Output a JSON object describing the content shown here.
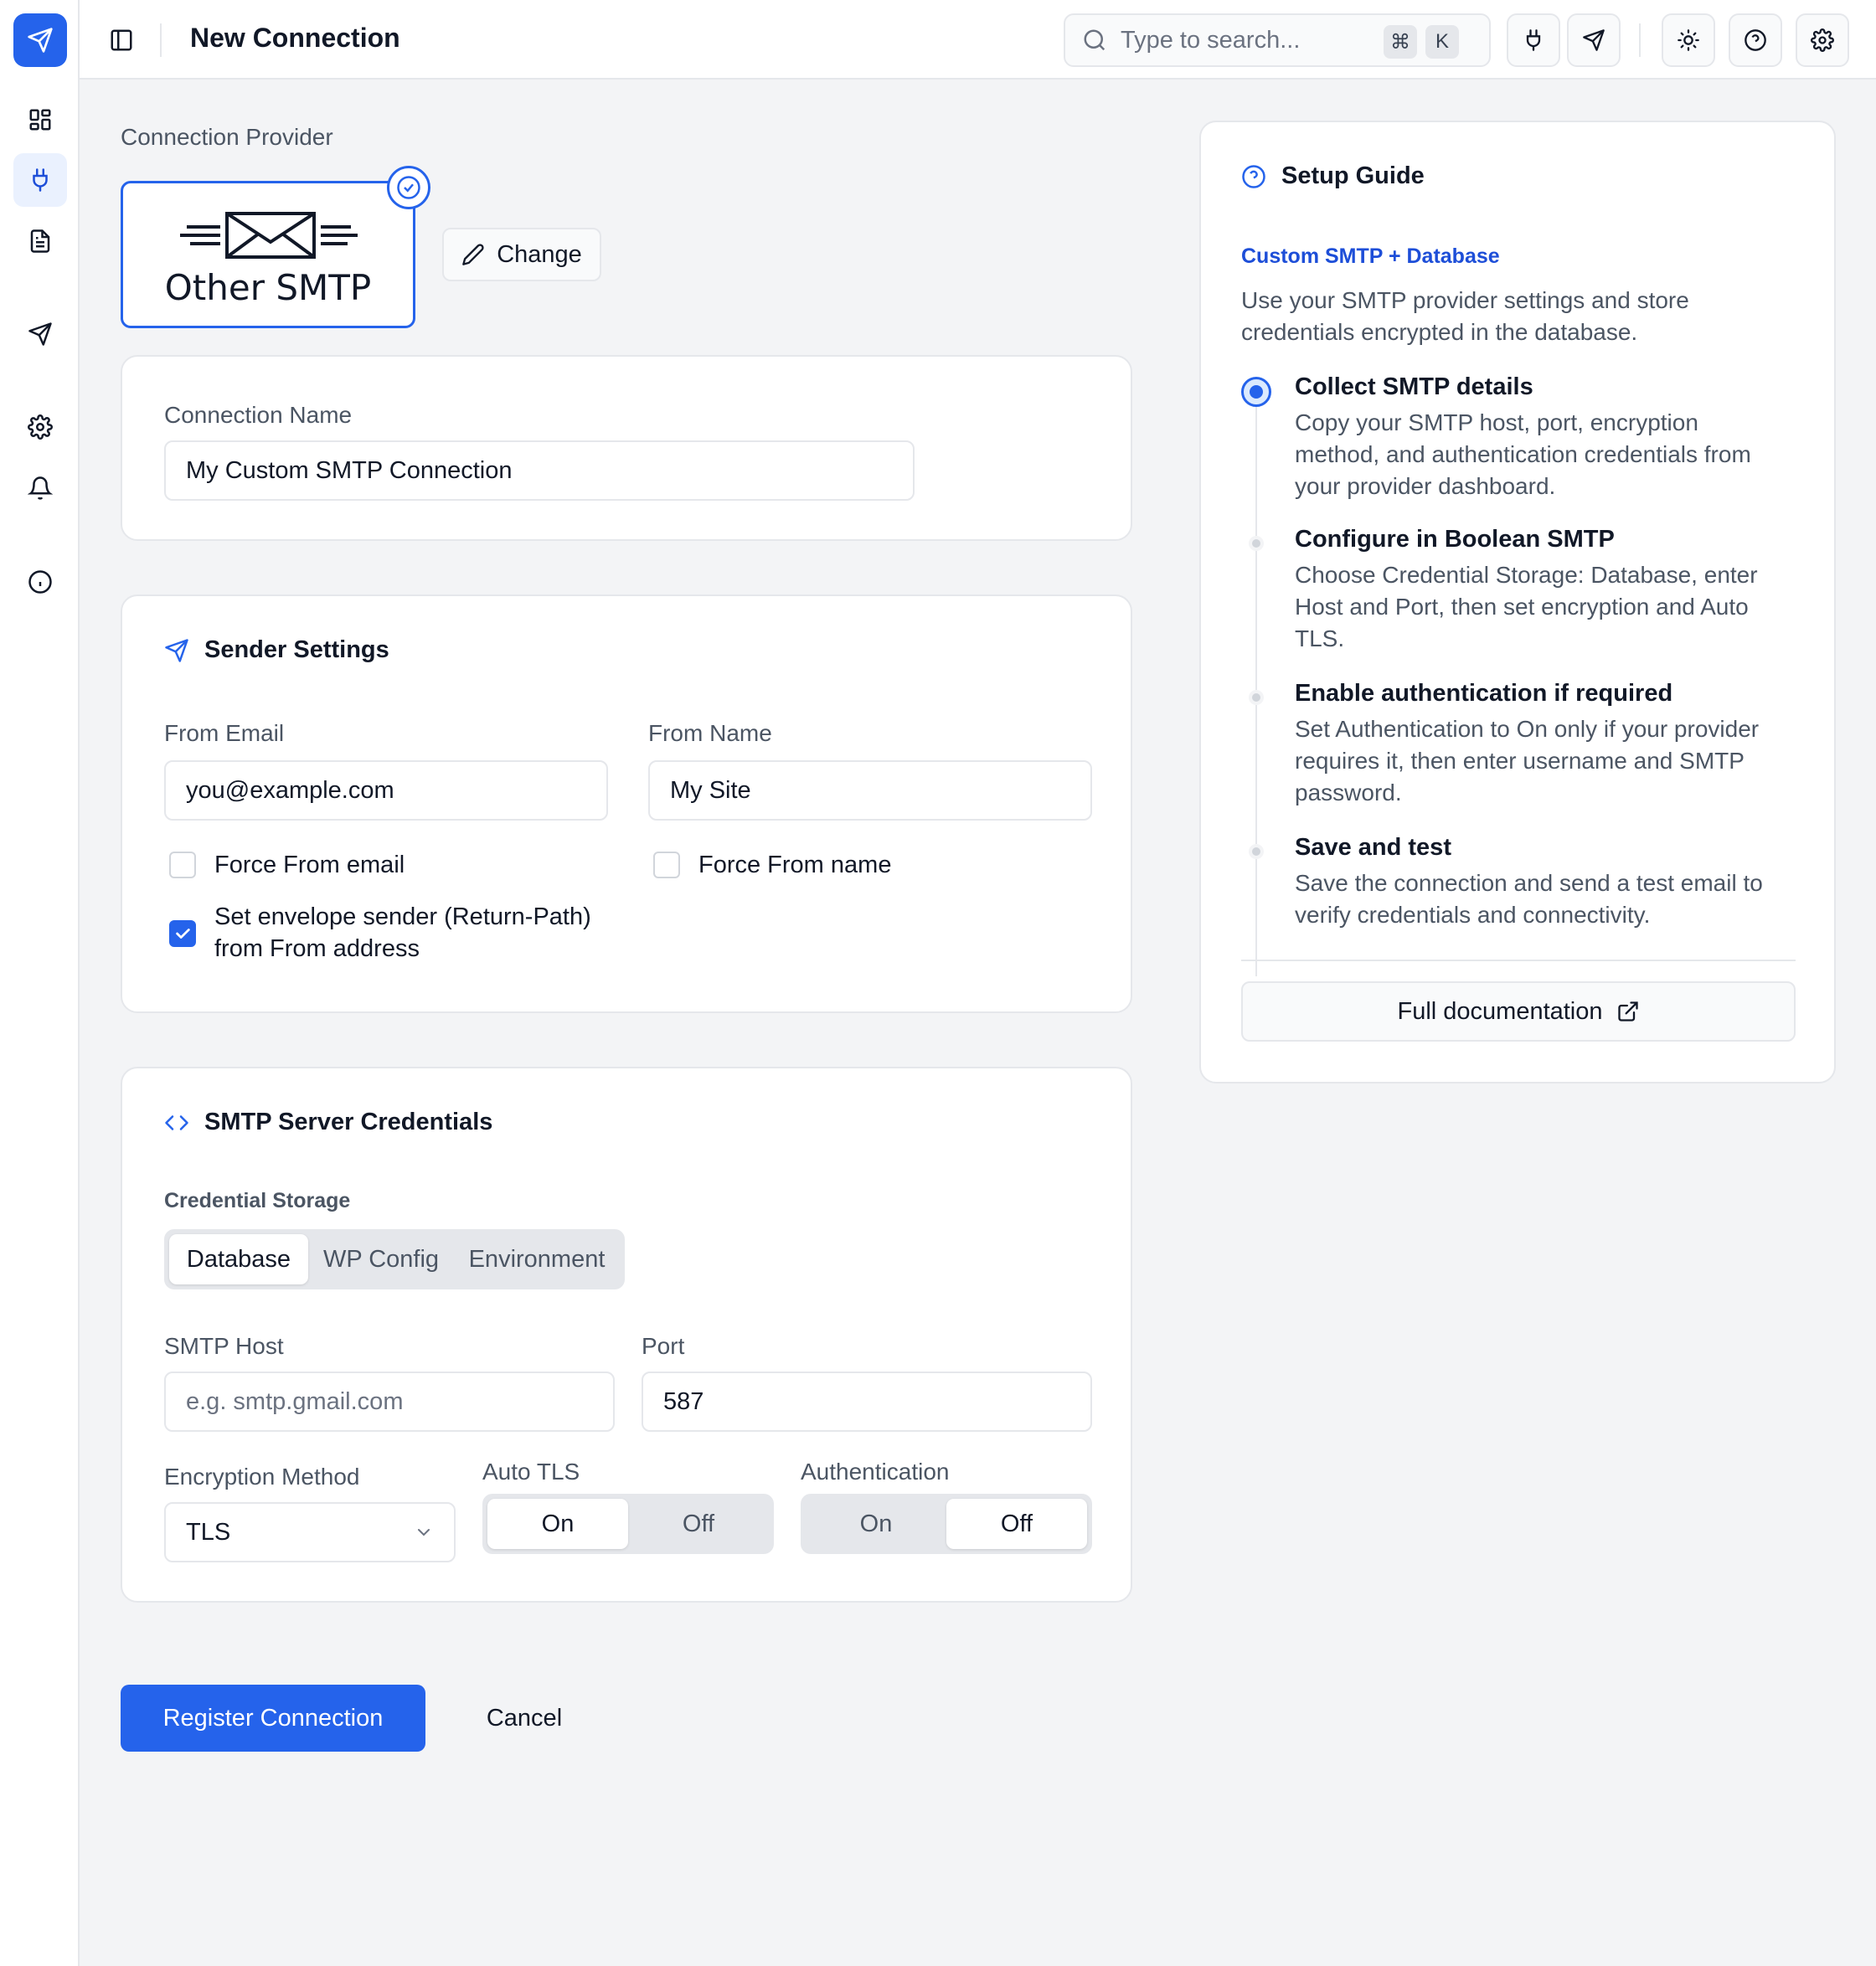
{
  "header": {
    "title": "New Connection",
    "search_placeholder": "Type to search...",
    "kbd_cmd": "⌘",
    "kbd_k": "K"
  },
  "provider": {
    "section_label": "Connection Provider",
    "name": "Other SMTP",
    "change_label": "Change"
  },
  "connection": {
    "name_label": "Connection Name",
    "name_value": "My Custom SMTP Connection"
  },
  "sender": {
    "title": "Sender Settings",
    "from_email_label": "From Email",
    "from_email_value": "you@example.com",
    "from_name_label": "From Name",
    "from_name_value": "My Site",
    "force_email_label": "Force From email",
    "force_name_label": "Force From name",
    "envelope_label_line1": "Set envelope sender (Return-Path)",
    "envelope_label_line2": "from From address",
    "force_email_checked": false,
    "force_name_checked": false,
    "envelope_checked": true
  },
  "smtp": {
    "title": "SMTP Server Credentials",
    "storage_label": "Credential Storage",
    "storage_options": [
      "Database",
      "WP Config",
      "Environment"
    ],
    "storage_selected": "Database",
    "host_label": "SMTP Host",
    "host_placeholder": "e.g. smtp.gmail.com",
    "port_label": "Port",
    "port_value": "587",
    "encryption_label": "Encryption Method",
    "encryption_value": "TLS",
    "autotls_label": "Auto TLS",
    "autotls_options": [
      "On",
      "Off"
    ],
    "autotls_selected": "On",
    "auth_label": "Authentication",
    "auth_options": [
      "On",
      "Off"
    ],
    "auth_selected": "Off"
  },
  "actions": {
    "register_label": "Register Connection",
    "cancel_label": "Cancel"
  },
  "guide": {
    "title": "Setup Guide",
    "subtitle": "Custom SMTP + Database",
    "intro_line1": "Use your SMTP provider settings and store",
    "intro_line2": "credentials encrypted in the database.",
    "steps": [
      {
        "title": "Collect SMTP details",
        "lines": [
          "Copy your SMTP host, port, encryption",
          "method, and authentication credentials from",
          "your provider dashboard."
        ]
      },
      {
        "title": "Configure in Boolean SMTP",
        "lines": [
          "Choose Credential Storage: Database, enter",
          "Host and Port, then set encryption and Auto",
          "TLS."
        ]
      },
      {
        "title": "Enable authentication if required",
        "lines": [
          "Set Authentication to On only if your provider",
          "requires it, then enter username and SMTP",
          "password."
        ]
      },
      {
        "title": "Save and test",
        "lines": [
          "Save the connection and send a test email to",
          "verify credentials and connectivity."
        ]
      }
    ],
    "docs_label": "Full documentation"
  },
  "colors": {
    "accent": "#2563eb",
    "background": "#f3f4f6",
    "border": "#e5e7eb"
  },
  "icons": {
    "sidebar": [
      "paper-plane-icon",
      "dashboard-icon",
      "plug-icon",
      "document-icon",
      "send-icon",
      "gear-icon",
      "bell-icon",
      "info-icon"
    ],
    "header": [
      "sidebar-toggle-icon",
      "search-icon",
      "plug-icon",
      "send-icon",
      "sun-icon",
      "help-icon",
      "gear-icon"
    ]
  }
}
